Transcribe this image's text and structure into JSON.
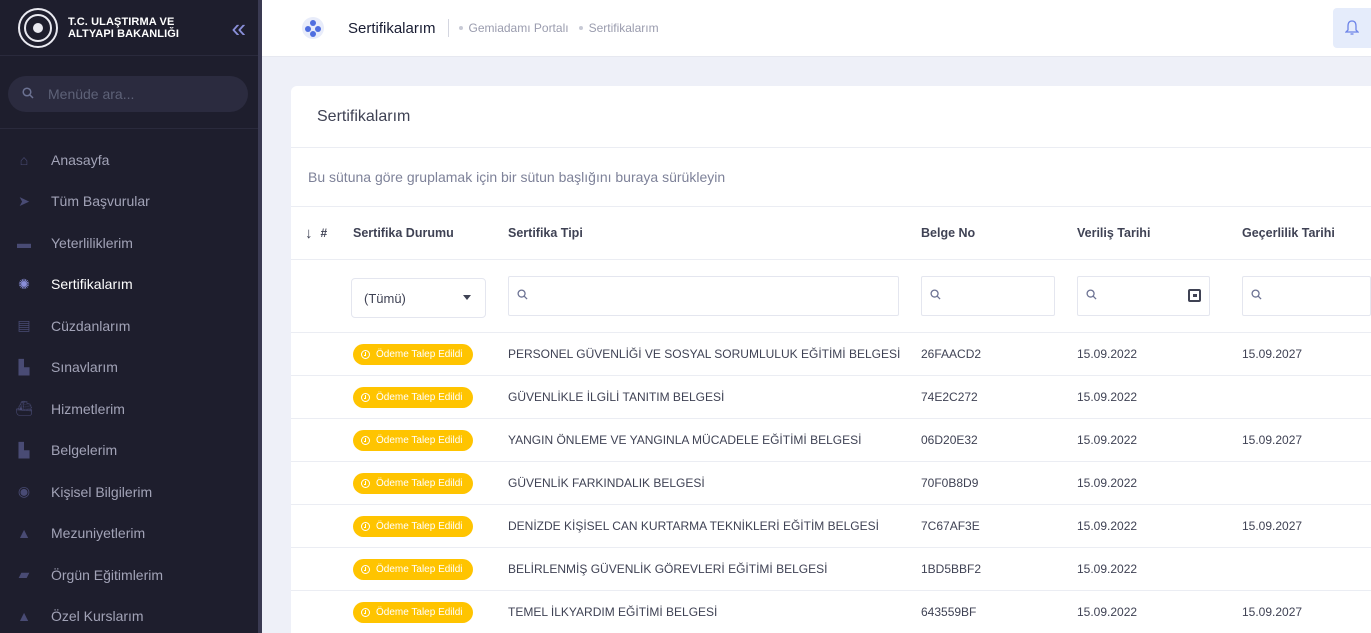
{
  "sidebar": {
    "brand_line1": "T.C. ULAŞTIRMA VE",
    "brand_line2": "ALTYAPI BAKANLIĞI",
    "collapse_icon": "double-chevron-left-icon",
    "search_placeholder": "Menüde ara...",
    "items": [
      {
        "label": "Anasayfa",
        "icon": "home-icon",
        "glyph": "⌂"
      },
      {
        "label": "Tüm Başvurular",
        "icon": "paper-plane-icon",
        "glyph": "➤"
      },
      {
        "label": "Yeterliliklerim",
        "icon": "briefcase-icon",
        "glyph": "▬"
      },
      {
        "label": "Sertifikalarım",
        "icon": "certificate-icon",
        "glyph": "✺"
      },
      {
        "label": "Cüzdanlarım",
        "icon": "id-card-icon",
        "glyph": "▤"
      },
      {
        "label": "Sınavlarım",
        "icon": "document-icon",
        "glyph": "▙"
      },
      {
        "label": "Hizmetlerim",
        "icon": "ship-icon",
        "glyph": "⛴"
      },
      {
        "label": "Belgelerim",
        "icon": "file-icon",
        "glyph": "▙"
      },
      {
        "label": "Kişisel Bilgilerim",
        "icon": "user-circle-icon",
        "glyph": "◉"
      },
      {
        "label": "Mezuniyetlerim",
        "icon": "graduation-cap-icon",
        "glyph": "▲"
      },
      {
        "label": "Örgün Eğitimlerim",
        "icon": "book-icon",
        "glyph": "▰"
      },
      {
        "label": "Özel Kurslarım",
        "icon": "graduation-cap-icon",
        "glyph": "▲"
      }
    ],
    "active_index": 3
  },
  "header": {
    "title": "Sertifikalarım",
    "breadcrumb": [
      "Gemiadamı Portalı",
      "Sertifikalarım"
    ]
  },
  "card": {
    "title": "Sertifikalarım",
    "group_panel_text": "Bu sütuna göre gruplamak için bir sütun başlığını buraya sürükleyin"
  },
  "table": {
    "columns": {
      "sort_arrow": "↓",
      "index": "#",
      "status": "Sertifika Durumu",
      "type": "Sertifika Tipi",
      "no": "Belge No",
      "issue_date": "Veriliş Tarihi",
      "valid_date": "Geçerlilik Tarihi"
    },
    "filter_select_value": "(Tümü)",
    "rows": [
      {
        "status": "Ödeme Talep Edildi",
        "type": "PERSONEL GÜVENLİĞİ VE SOSYAL SORUMLULUK EĞİTİMİ BELGESİ",
        "no": "26FAACD2",
        "issue_date": "15.09.2022",
        "valid_date": "15.09.2027"
      },
      {
        "status": "Ödeme Talep Edildi",
        "type": "GÜVENLİKLE İLGİLİ TANITIM BELGESİ",
        "no": "74E2C272",
        "issue_date": "15.09.2022",
        "valid_date": ""
      },
      {
        "status": "Ödeme Talep Edildi",
        "type": "YANGIN ÖNLEME VE YANGINLA MÜCADELE EĞİTİMİ BELGESİ",
        "no": "06D20E32",
        "issue_date": "15.09.2022",
        "valid_date": "15.09.2027"
      },
      {
        "status": "Ödeme Talep Edildi",
        "type": "GÜVENLİK FARKINDALIK BELGESİ",
        "no": "70F0B8D9",
        "issue_date": "15.09.2022",
        "valid_date": ""
      },
      {
        "status": "Ödeme Talep Edildi",
        "type": "DENİZDE KİŞİSEL CAN KURTARMA TEKNİKLERİ EĞİTİM BELGESİ",
        "no": "7C67AF3E",
        "issue_date": "15.09.2022",
        "valid_date": "15.09.2027"
      },
      {
        "status": "Ödeme Talep Edildi",
        "type": "BELİRLENMİŞ GÜVENLİK GÖREVLERİ EĞİTİMİ BELGESİ",
        "no": "1BD5BBF2",
        "issue_date": "15.09.2022",
        "valid_date": ""
      },
      {
        "status": "Ödeme Talep Edildi",
        "type": "TEMEL İLKYARDIM EĞİTİMİ BELGESİ",
        "no": "643559BF",
        "issue_date": "15.09.2022",
        "valid_date": "15.09.2027"
      }
    ]
  },
  "colors": {
    "sidebar_bg": "#1e1e2d",
    "badge_bg": "#ffc400",
    "accent": "#8a8fd9"
  }
}
